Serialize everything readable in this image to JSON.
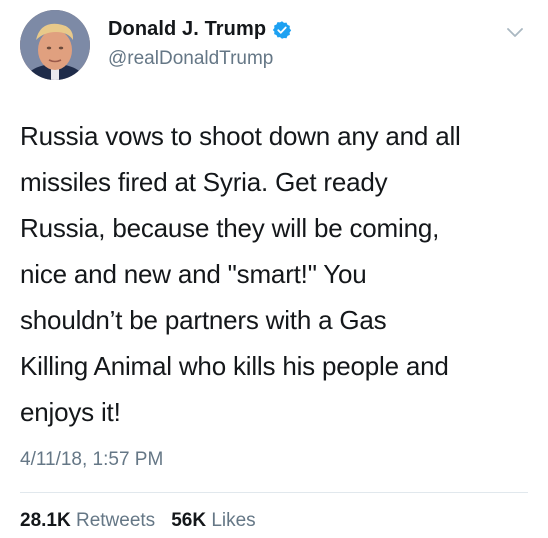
{
  "user": {
    "display_name": "Donald J. Trump",
    "handle": "@realDonaldTrump",
    "verified": true,
    "verified_color": "#1da1f2"
  },
  "tweet": {
    "text": "Russia vows to shoot down any and all\nmissiles fired at Syria. Get ready\nRussia,  because they will be coming,\nnice and new and \"smart!\" You\nshouldn’t be partners with a Gas\nKilling Animal who kills his people and\nenjoys it!",
    "timestamp": "4/11/18, 1:57 PM"
  },
  "stats": {
    "retweets_count": "28.1K",
    "retweets_label": "Retweets",
    "likes_count": "56K",
    "likes_label": "Likes"
  },
  "icons": {
    "verified": "verified-badge-icon",
    "menu": "chevron-down-icon"
  }
}
